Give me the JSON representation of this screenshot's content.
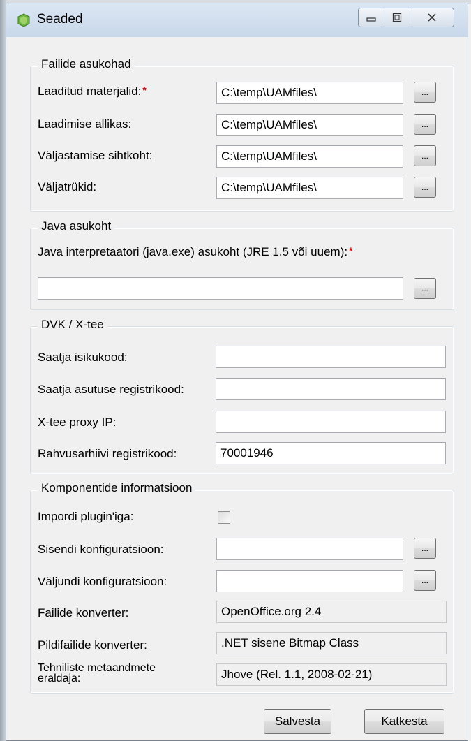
{
  "window": {
    "title": "Seaded"
  },
  "groups": {
    "file_locations": {
      "legend": "Failide asukohad",
      "rows": [
        {
          "label": "Laaditud materjalid:",
          "required": "*",
          "value": "C:\\temp\\UAMfiles\\"
        },
        {
          "label": "Laadimise allikas:",
          "value": "C:\\temp\\UAMfiles\\"
        },
        {
          "label": "Väljastamise sihtkoht:",
          "value": "C:\\temp\\UAMfiles\\"
        },
        {
          "label": "Väljatrükid:",
          "value": "C:\\temp\\UAMfiles\\"
        }
      ]
    },
    "java": {
      "legend": "Java asukoht",
      "label": "Java interpretaatori (java.exe) asukoht (JRE 1.5 või uuem):",
      "required": "*",
      "value": ""
    },
    "dvk": {
      "legend": "DVK / X-tee",
      "rows": [
        {
          "label": "Saatja isikukood:",
          "value": ""
        },
        {
          "label": "Saatja asutuse registrikood:",
          "value": ""
        },
        {
          "label": "X-tee proxy IP:",
          "value": ""
        },
        {
          "label": "Rahvusarhiivi registrikood:",
          "value": "70001946"
        }
      ]
    },
    "components": {
      "legend": "Komponentide informatsioon",
      "import_label": "Impordi plugin'iga:",
      "import_checked": false,
      "input_config_label": "Sisendi konfiguratsioon:",
      "input_config_value": "",
      "output_config_label": "Väljundi konfiguratsioon:",
      "output_config_value": "",
      "file_converter_label": "Failide konverter:",
      "file_converter_value": "OpenOffice.org 2.4",
      "image_converter_label": "Pildifailide konverter:",
      "image_converter_value": ".NET sisene Bitmap Class",
      "metadata_label_line1": "Tehniliste metaandmete",
      "metadata_label_line2": "eraldaja:",
      "metadata_value": "Jhove (Rel. 1.1, 2008-02-21)"
    }
  },
  "browse_label": "...",
  "buttons": {
    "save": "Salvesta",
    "cancel": "Katkesta"
  }
}
